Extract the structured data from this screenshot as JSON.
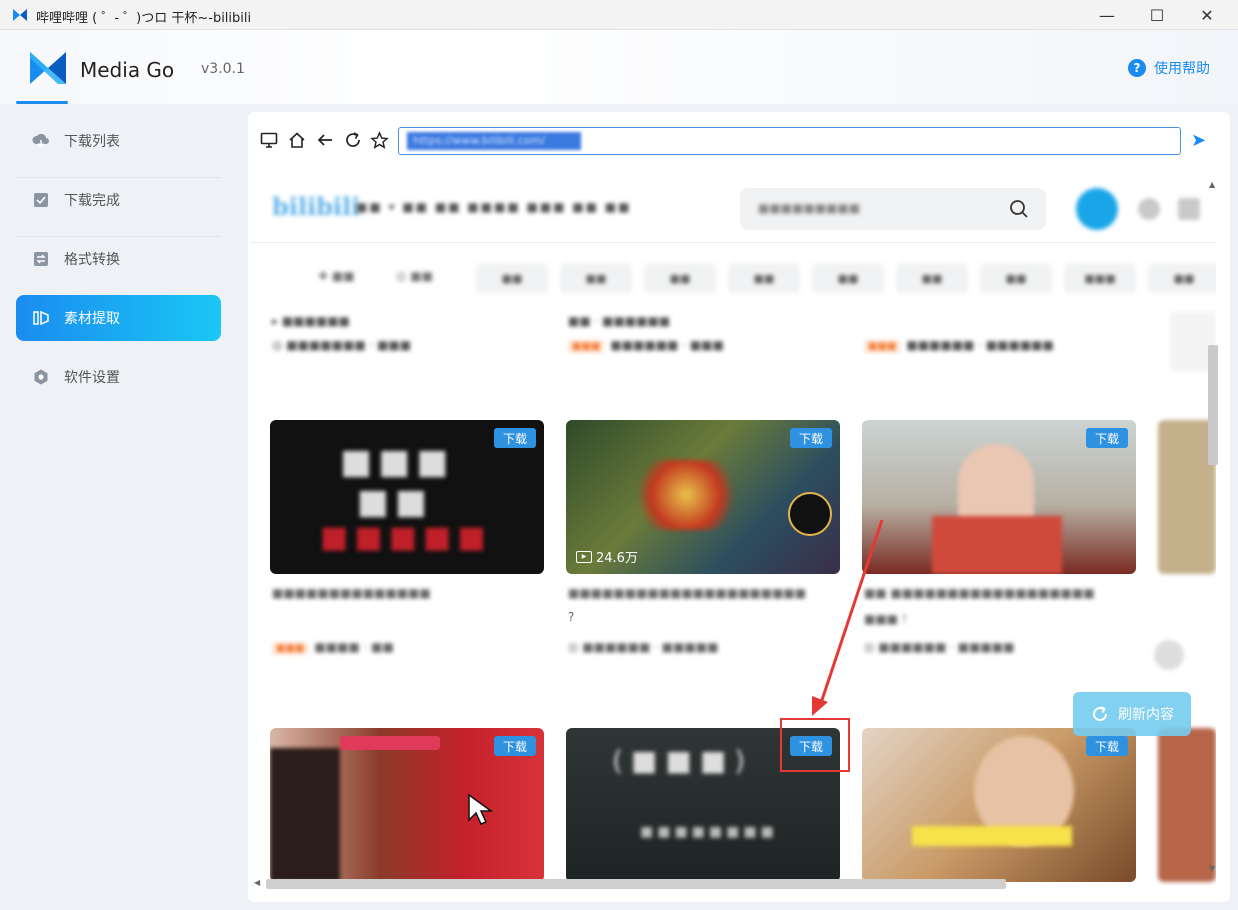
{
  "window": {
    "title": "哔哩哔哩 ( ゜- ゜)つロ 干杯~-bilibili",
    "minimize": "—",
    "maximize": "☐",
    "close": "✕"
  },
  "app": {
    "name": "Media Go",
    "version": "v3.0.1",
    "help_label": "使用帮助",
    "accent": "#1a8cf0"
  },
  "sidebar": {
    "items": [
      {
        "label": "下载列表",
        "icon": "cloud-download-icon"
      },
      {
        "label": "下载完成",
        "icon": "download-complete-icon"
      },
      {
        "label": "格式转换",
        "icon": "format-convert-icon"
      },
      {
        "label": "素材提取",
        "icon": "material-extract-icon",
        "active": true
      },
      {
        "label": "软件设置",
        "icon": "settings-icon"
      }
    ]
  },
  "browser": {
    "url": "https://www.bilibili.com/",
    "nav_icons": [
      "monitor-icon",
      "home-icon",
      "back-icon",
      "refresh-icon",
      "star-icon"
    ],
    "send_icon": "send-icon"
  },
  "videos": {
    "download_label": "下载",
    "card2_views": "24.6万",
    "card2_title_tail": "?",
    "refresh_label": "刷新内容"
  }
}
